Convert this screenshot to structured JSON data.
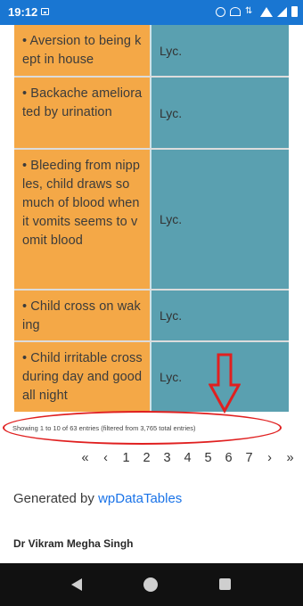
{
  "status": {
    "time": "19:12"
  },
  "table": {
    "rows": [
      {
        "symptom": "• Aversion to being kept in house",
        "remedy": "Lyc."
      },
      {
        "symptom": "• Backache ameliorated by urination",
        "remedy": "Lyc."
      },
      {
        "symptom": "• Bleeding from nipples, child draws so much of blood when it vomits seems to vomit blood",
        "remedy": "Lyc."
      },
      {
        "symptom": "• Child cross on waking",
        "remedy": "Lyc."
      },
      {
        "symptom": "• Child irritable cross during day and good all night",
        "remedy": "Lyc."
      }
    ]
  },
  "info": {
    "text": "Showing 1 to 10 of 63 entries (filtered from 3,765 total entries)"
  },
  "pagination": {
    "items": [
      "«",
      "‹",
      "1",
      "2",
      "3",
      "4",
      "5",
      "6",
      "7",
      "›",
      "»"
    ]
  },
  "footer": {
    "generated_prefix": "Generated by",
    "generated_link": "wpDataTables",
    "author": "Dr Vikram Megha Singh"
  },
  "colors": {
    "symptom_bg": "#f4a847",
    "remedy_bg": "#5aa0b0",
    "annotation": "#e02020",
    "link": "#1a73e8"
  }
}
